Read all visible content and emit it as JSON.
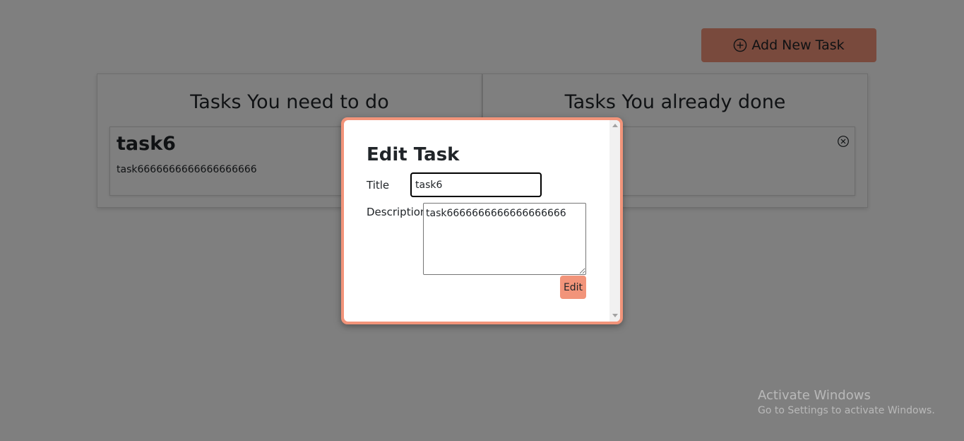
{
  "header": {
    "add_task_label": "Add New Task",
    "add_task_icon": "plus-circle-icon"
  },
  "columns": {
    "todo": {
      "heading": "Tasks You need to do",
      "tasks": [
        {
          "title": "task6",
          "description": "task6666666666666666666"
        }
      ]
    },
    "done": {
      "heading": "Tasks You already done",
      "tasks": [
        {
          "close_icon": "close-circle-icon"
        }
      ]
    }
  },
  "modal": {
    "title": "Edit Task",
    "title_label": "Title",
    "title_value": "task6",
    "description_label": "Description",
    "description_value": "task6666666666666666666",
    "edit_label": "Edit"
  },
  "watermark": {
    "line1": "Activate Windows",
    "line2": "Go to Settings to activate Windows."
  },
  "colors": {
    "accent": "#f2947a",
    "overlay": "rgba(0,0,0,0.5)"
  }
}
